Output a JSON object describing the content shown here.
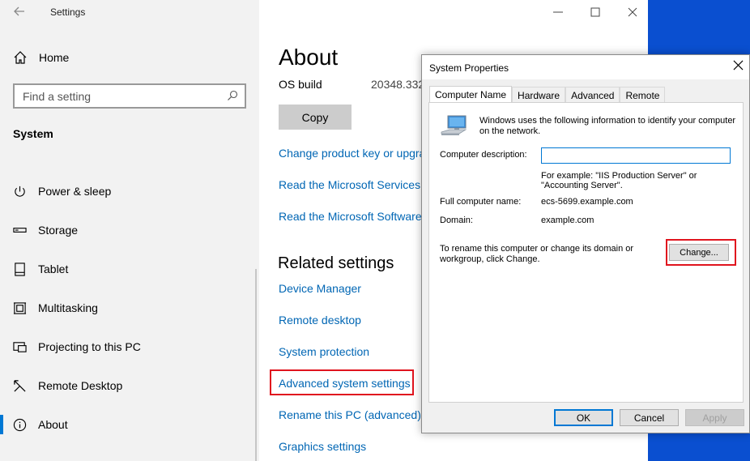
{
  "settings": {
    "app_title": "Settings",
    "home_label": "Home",
    "search_placeholder": "Find a setting",
    "section_label": "System",
    "nav_items": [
      {
        "label": "Power & sleep",
        "icon": "power-icon"
      },
      {
        "label": "Storage",
        "icon": "storage-icon"
      },
      {
        "label": "Tablet",
        "icon": "tablet-icon"
      },
      {
        "label": "Multitasking",
        "icon": "multitasking-icon"
      },
      {
        "label": "Projecting to this PC",
        "icon": "projecting-icon"
      },
      {
        "label": "Remote Desktop",
        "icon": "remote-desktop-icon"
      },
      {
        "label": "About",
        "icon": "info-icon",
        "active": true
      }
    ]
  },
  "about": {
    "title": "About",
    "os_build_label": "OS build",
    "os_build_value": "20348.332",
    "copy_label": "Copy",
    "links": [
      "Change product key or upgra",
      "Read the Microsoft Services A",
      "Read the Microsoft Software"
    ],
    "related_title": "Related settings",
    "related_links": [
      "Device Manager",
      "Remote desktop",
      "System protection",
      "Advanced system settings",
      "Rename this PC (advanced)",
      "Graphics settings"
    ]
  },
  "dialog": {
    "title": "System Properties",
    "close_label": "✕",
    "tabs": [
      "Computer Name",
      "Hardware",
      "Advanced",
      "Remote"
    ],
    "active_tab": "Computer Name",
    "intro": "Windows uses the following information to identify your computer on the network.",
    "description_label": "Computer description:",
    "description_value": "",
    "example_text": "For example: \"IIS Production Server\" or \"Accounting Server\".",
    "full_name_label": "Full computer name:",
    "full_name_value": "ecs-5699.example.com",
    "domain_label": "Domain:",
    "domain_value": "example.com",
    "rename_text": "To rename this computer or change its domain or workgroup, click Change.",
    "change_label": "Change...",
    "ok_label": "OK",
    "cancel_label": "Cancel",
    "apply_label": "Apply"
  },
  "colors": {
    "link": "#0066b4",
    "accent": "#0078d4",
    "highlight": "#e0141e",
    "desktop": "#0a4fd0"
  }
}
